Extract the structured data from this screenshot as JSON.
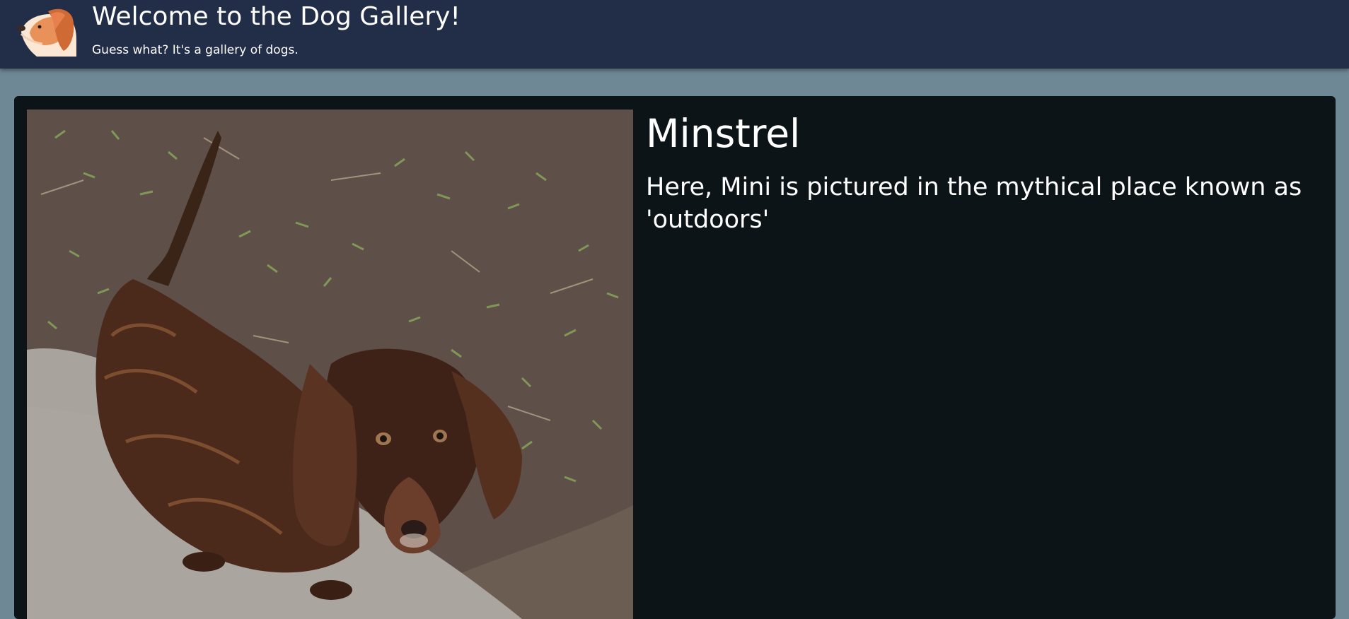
{
  "header": {
    "title": "Welcome to the Dog Gallery!",
    "subtitle": "Guess what? It's a gallery of dogs.",
    "logo_icon": "dog-head-icon"
  },
  "gallery": {
    "items": [
      {
        "name": "Minstrel",
        "caption": "Here, Mini is pictured in the mythical place known as 'outdoors'",
        "photo_icon": "dog-photo"
      }
    ]
  },
  "colors": {
    "page_background": "#6f8895",
    "header_background": "#222d48",
    "card_background": "#0d1418",
    "text": "#ffffff"
  }
}
